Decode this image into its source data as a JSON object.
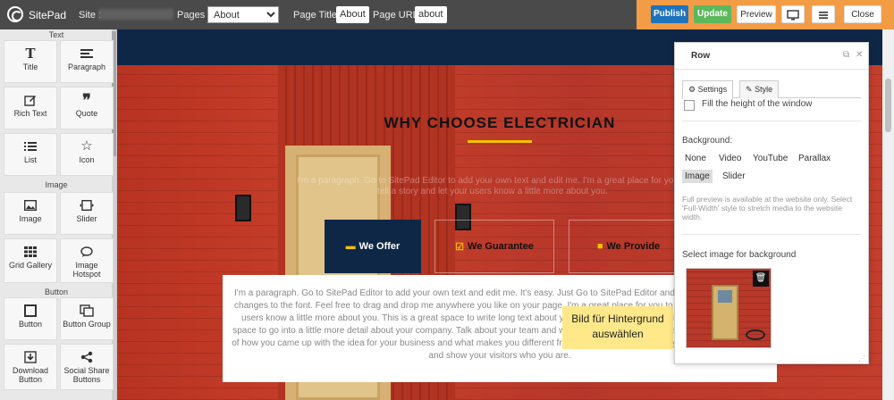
{
  "app": {
    "brand": "SitePad"
  },
  "topbar": {
    "site_label": "Site :",
    "pages_label": "Pages :",
    "pages_selected": "About",
    "page_title_label": "Page Title:",
    "page_title_value": "About",
    "page_url_label": "Page URL:",
    "page_url_value": "about",
    "publish_label": "Publish",
    "update_label": "Update",
    "preview_label": "Preview",
    "close_label": "Close"
  },
  "sidebar": {
    "sections": {
      "text": "Text",
      "image": "Image",
      "button": "Button"
    },
    "tiles": {
      "title": "Title",
      "paragraph": "Paragraph",
      "rich_text": "Rich Text",
      "quote": "Quote",
      "list": "List",
      "icon": "Icon",
      "image": "Image",
      "slider": "Slider",
      "grid_gallery": "Grid Gallery",
      "image_hotspot": "Image Hotspot",
      "button": "Button",
      "button_group": "Button Group",
      "download_button": "Download Button",
      "social_share_buttons": "Social Share Buttons"
    }
  },
  "canvas": {
    "heading": "WHY CHOOSE ELECTRICIAN",
    "faint_text": "I'm a paragraph. Go to SitePad Editor to add your own text and edit me. I'm a great place for you to tell a story and let your users know a little more about you.",
    "tabs": [
      "We Offer",
      "We Guarantee",
      "We Provide"
    ],
    "paragraph": "I'm a paragraph. Go to SitePad Editor to add your own text and edit me. It's easy. Just Go to SitePad Editor and edit content and make changes to the font. Feel free to drag and drop me anywhere you like on your page. I'm a great place for you to tell a story and let your users know a little more about you. This is a great space to write long text about your company and your services. You can use this space to go into a little more detail about your company. Talk about your team and what services you provide. Tell your visitors the story of how you came up with the idea for your business and what makes you different from your competitors. Make your company stand out and show your visitors who you are.",
    "callout": "Bild für Hintergrund auswählen"
  },
  "panel": {
    "title": "Row",
    "tab_settings": "Settings",
    "tab_style": "Style",
    "fill_height_label": "Fill the height of the window",
    "background_label": "Background:",
    "background_options_row1": [
      "None",
      "Video",
      "YouTube",
      "Parallax"
    ],
    "background_options_row2": [
      "Image",
      "Slider"
    ],
    "background_selected": "Image",
    "note": "Full preview is available at the website only. Select 'Full-Width' style to stretch media to the website width.",
    "select_image_label": "Select image for background"
  }
}
